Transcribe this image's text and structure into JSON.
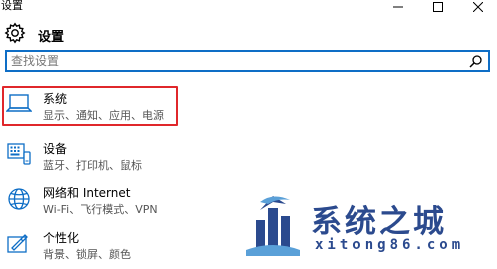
{
  "window": {
    "title": "设置",
    "controls": {
      "minimize_icon": "minimize-icon",
      "maximize_icon": "maximize-icon",
      "close_icon": "close-icon"
    }
  },
  "header": {
    "title": "设置",
    "icon": "gear-icon"
  },
  "search": {
    "placeholder": "查找设置",
    "value": "",
    "icon": "search-icon"
  },
  "categories": [
    {
      "label": "系统",
      "description": "显示、通知、应用、电源",
      "icon": "laptop-icon",
      "highlighted": true
    },
    {
      "label": "设备",
      "description": "蓝牙、打印机、鼠标",
      "icon": "keyboard-icon",
      "highlighted": false
    },
    {
      "label": "网络和 Internet",
      "description": "Wi-Fi、飞行模式、VPN",
      "icon": "globe-icon",
      "highlighted": false
    },
    {
      "label": "个性化",
      "description": "背景、锁屏、颜色",
      "icon": "personalization-icon",
      "highlighted": false
    }
  ],
  "watermark": {
    "text": "系统之城",
    "url": "xitong86.com"
  },
  "colors": {
    "accent": "#0e6ec6",
    "highlight_border": "#e0272b",
    "watermark": "#2b4a8e"
  }
}
